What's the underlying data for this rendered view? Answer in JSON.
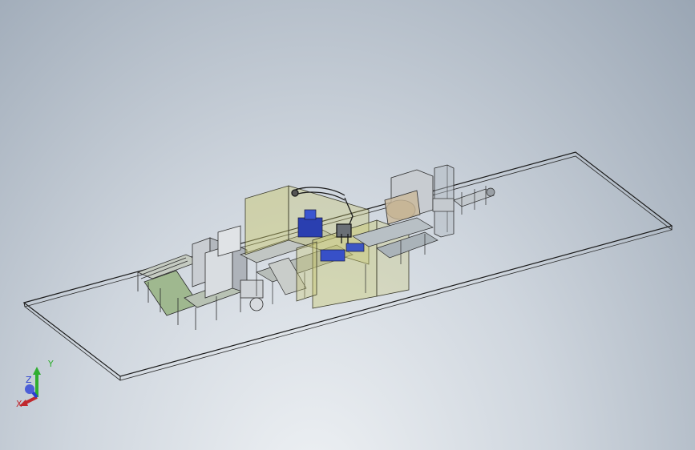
{
  "viewport": {
    "background_top": "#97a4b3",
    "background_bottom": "#eef1f4"
  },
  "model": {
    "description_icon": "factory-assembly-line-icon",
    "plate_color": "#1a1a1a",
    "guard_color": "#c9c76a",
    "accent_blue": "#2a3fb0",
    "conveyor_green": "#9fb88f"
  },
  "triad": {
    "x_label": "X",
    "y_label": "Y",
    "z_label": "Z",
    "x_color": "#c0282d",
    "y_color": "#2fae2f",
    "z_color": "#2a3fd0"
  }
}
